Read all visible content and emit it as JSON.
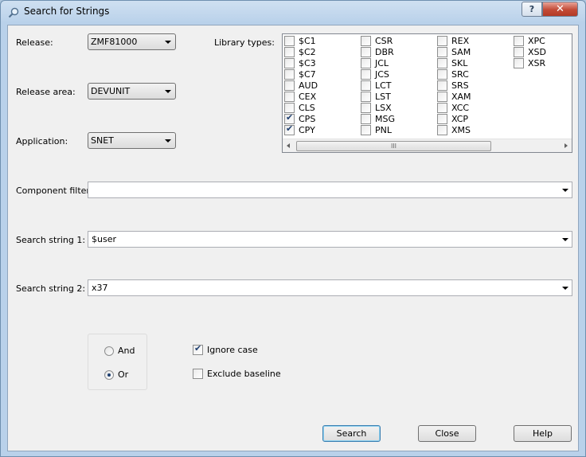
{
  "window": {
    "title": "Search for Strings",
    "help_label": "?",
    "close_label": "✕"
  },
  "form": {
    "release": {
      "label": "Release:",
      "value": "ZMF81000"
    },
    "release_area": {
      "label": "Release area:",
      "value": "DEVUNIT"
    },
    "application": {
      "label": "Application:",
      "value": "SNET"
    },
    "library_types_label": "Library types:",
    "component_filter": {
      "label": "Component filter:",
      "value": ""
    },
    "search_string_1": {
      "label": "Search string 1:",
      "value": "$user"
    },
    "search_string_2": {
      "label": "Search string 2:",
      "value": "x37"
    }
  },
  "library_types": [
    {
      "name": "$C1",
      "checked": false
    },
    {
      "name": "$C2",
      "checked": false
    },
    {
      "name": "$C3",
      "checked": false
    },
    {
      "name": "$C7",
      "checked": false
    },
    {
      "name": "AUD",
      "checked": false
    },
    {
      "name": "CEX",
      "checked": false
    },
    {
      "name": "CLS",
      "checked": false
    },
    {
      "name": "CPS",
      "checked": true
    },
    {
      "name": "CPY",
      "checked": true
    },
    {
      "name": "CSR",
      "checked": false
    },
    {
      "name": "DBR",
      "checked": false
    },
    {
      "name": "JCL",
      "checked": false
    },
    {
      "name": "JCS",
      "checked": false
    },
    {
      "name": "LCT",
      "checked": false
    },
    {
      "name": "LST",
      "checked": false
    },
    {
      "name": "LSX",
      "checked": false
    },
    {
      "name": "MSG",
      "checked": false
    },
    {
      "name": "PNL",
      "checked": false
    },
    {
      "name": "REX",
      "checked": false
    },
    {
      "name": "SAM",
      "checked": false
    },
    {
      "name": "SKL",
      "checked": false
    },
    {
      "name": "SRC",
      "checked": false
    },
    {
      "name": "SRS",
      "checked": false
    },
    {
      "name": "XAM",
      "checked": false
    },
    {
      "name": "XCC",
      "checked": false
    },
    {
      "name": "XCP",
      "checked": false
    },
    {
      "name": "XMS",
      "checked": false
    },
    {
      "name": "XPC",
      "checked": false
    },
    {
      "name": "XSD",
      "checked": false
    },
    {
      "name": "XSR",
      "checked": false
    }
  ],
  "scrollbar_grip": "III",
  "logic": {
    "and_label": "And",
    "or_label": "Or",
    "selected": "Or"
  },
  "options": {
    "ignore_case": {
      "label": "Ignore case",
      "checked": true
    },
    "exclude_baseline": {
      "label": "Exclude baseline",
      "checked": false
    }
  },
  "buttons": {
    "search": "Search",
    "close": "Close",
    "help": "Help"
  }
}
